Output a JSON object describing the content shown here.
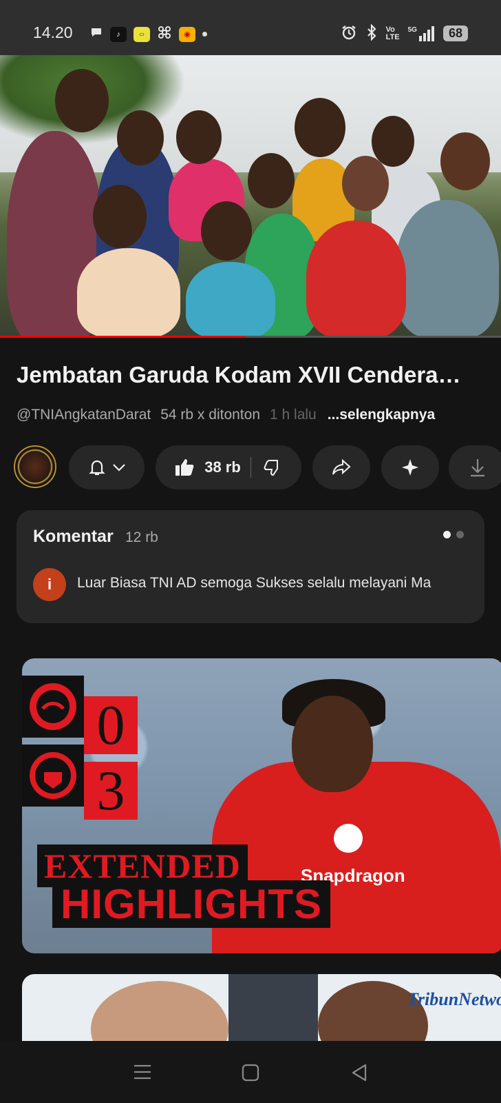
{
  "status_bar": {
    "time": "14.20",
    "network": "5G",
    "volte": "Vo\nLTE",
    "battery": "68"
  },
  "video": {
    "title": "Jembatan Garuda Kodam XVII Cendera…",
    "channel": "@TNIAngkatanDarat",
    "views": "54 rb x ditonton",
    "time_ago": "1 h lalu",
    "more_label": "...selengkapnya",
    "progress": 0.49
  },
  "actions": {
    "like_count": "38 rb"
  },
  "comments": {
    "heading": "Komentar",
    "count": "12 rb",
    "first_avatar_letter": "i",
    "first_comment": "Luar Biasa TNI AD semoga Sukses selalu melayani Ma"
  },
  "next_video": {
    "score_home": "0",
    "score_away": "3",
    "line1": "EXTENDED",
    "line2": "HIGHLIGHTS",
    "sponsor": "Snapdragon"
  },
  "third_video": {
    "brand": "TribunNetwork"
  },
  "colors": {
    "accent_red": "#ff0000",
    "background": "#0f0f0f",
    "pill": "#272727"
  }
}
